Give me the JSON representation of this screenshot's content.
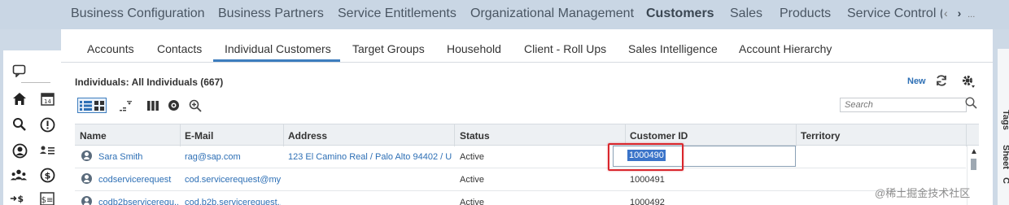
{
  "topnav": {
    "items": [
      "Business Configuration",
      "Business Partners",
      "Service Entitlements",
      "Organizational Management",
      "Customers",
      "Sales",
      "Products",
      "Service Control ("
    ],
    "active": "Customers",
    "prev_icon": "chevron-left-icon",
    "next_icon": "chevron-right-icon",
    "more_label": "..."
  },
  "subtabs": {
    "items": [
      "Accounts",
      "Contacts",
      "Individual Customers",
      "Target Groups",
      "Household",
      "Client - Roll Ups",
      "Sales Intelligence",
      "Account Hierarchy"
    ],
    "active": "Individual Customers"
  },
  "list": {
    "title": "Individuals: All Individuals (667)",
    "new_label": "New",
    "search_placeholder": "Search"
  },
  "table": {
    "columns": [
      "Name",
      "E-Mail",
      "Address",
      "Status",
      "Customer ID",
      "Territory"
    ],
    "rows": [
      {
        "name": "Sara Smith",
        "email": "rag@sap.com",
        "address": "123 El Camino Real / Palo Alto 94402 / US",
        "status": "Active",
        "customer_id": "1000490",
        "territory": ""
      },
      {
        "name": "codservicerequest",
        "email": "cod.servicerequest@my...",
        "address": "",
        "status": "Active",
        "customer_id": "1000491",
        "territory": ""
      },
      {
        "name": "codb2bservicerequ...",
        "email": "cod.b2b.servicerequest...",
        "address": "",
        "status": "Active",
        "customer_id": "1000492",
        "territory": ""
      }
    ]
  },
  "sidebar": {
    "tags_label": "Tags",
    "sheet_label": "Sheet",
    "help_label": "Help C"
  },
  "watermark": "@稀土掘金技术社区",
  "colors": {
    "accent": "#3d7dbe",
    "link": "#2d6fb5",
    "highlight": "#d9262c",
    "selection": "#3b74c9"
  }
}
